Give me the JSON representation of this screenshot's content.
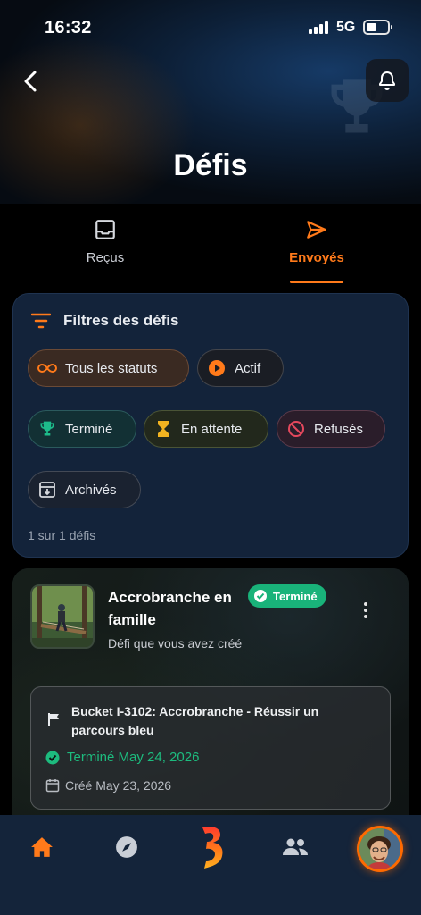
{
  "status_bar": {
    "time": "16:32",
    "network": "5G"
  },
  "header": {
    "title": "Défis"
  },
  "tabs": [
    {
      "label": "Reçus",
      "active": false
    },
    {
      "label": "Envoyés",
      "active": true
    }
  ],
  "filters": {
    "title": "Filtres des défis",
    "chips": {
      "all": "Tous les statuts",
      "actif": "Actif",
      "termine": "Terminé",
      "attente": "En attente",
      "refuses": "Refusés",
      "archives": "Archivés"
    },
    "selected": "Tous les statuts",
    "count": "1 sur 1 défis"
  },
  "challenge": {
    "title": "Accrobranche en famille",
    "badge": "Terminé",
    "subtitle": "Défi que vous avez créé",
    "bucket_title": "Bucket I-3102: Accrobranche - Réussir un parcours bleu",
    "completed": "Terminé May 24, 2026",
    "created": "Créé May 23, 2026"
  },
  "colors": {
    "accent": "#ff7a1a",
    "success": "#19b37a",
    "card": "#13233a",
    "nav": "#14243a"
  },
  "icons": [
    "back-arrow-icon",
    "bell-icon",
    "inbox-icon",
    "send-icon",
    "filter-icon",
    "infinity-icon",
    "play-icon",
    "trophy-icon",
    "hourglass-icon",
    "ban-icon",
    "archive-icon",
    "check-circle-icon",
    "flag-icon",
    "calendar-icon",
    "home-icon",
    "compass-icon",
    "brand-logo",
    "people-icon",
    "avatar"
  ]
}
